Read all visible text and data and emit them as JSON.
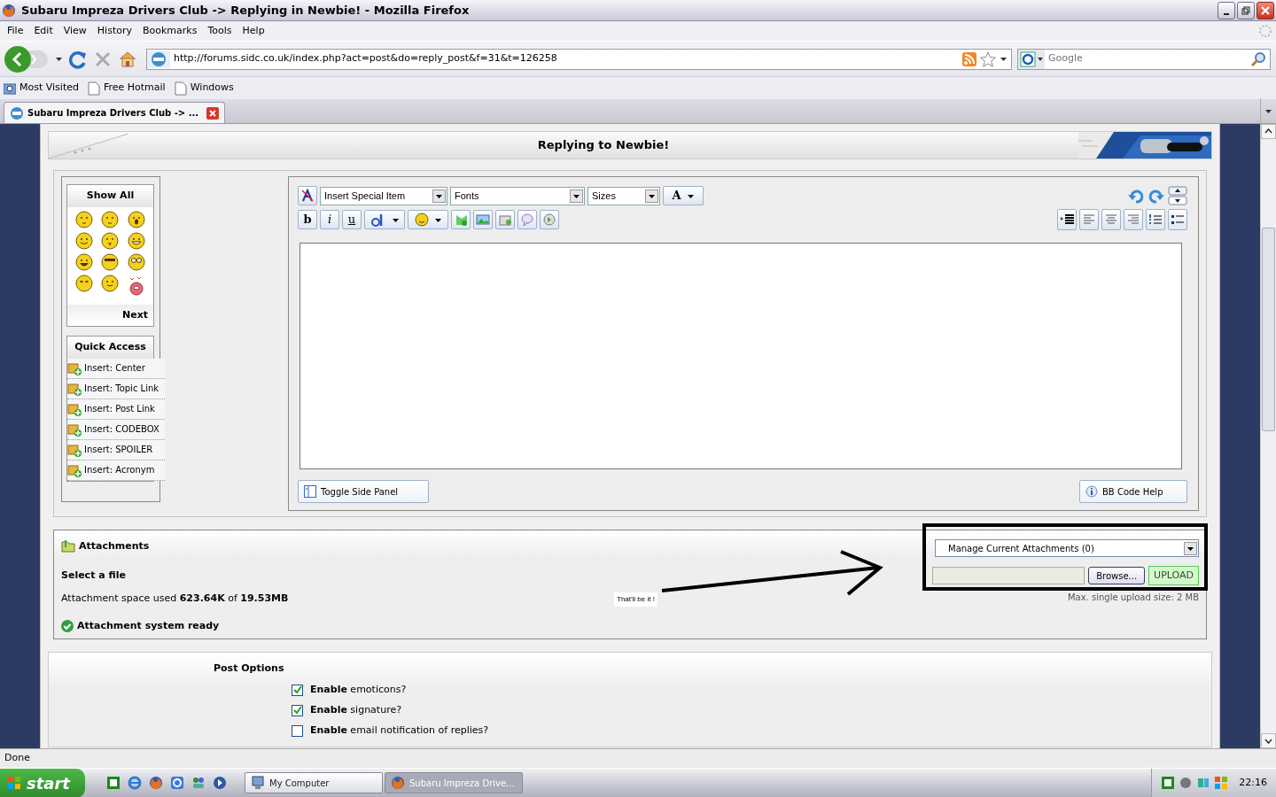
{
  "window": {
    "title": "Subaru Impreza Drivers Club -> Replying in Newbie! - Mozilla Firefox"
  },
  "menu": [
    "File",
    "Edit",
    "View",
    "History",
    "Bookmarks",
    "Tools",
    "Help"
  ],
  "address": {
    "value": "http://forums.sidc.co.uk/index.php?act=post&do=reply_post&f=31&t=126258"
  },
  "search": {
    "placeholder": "Google"
  },
  "bookmarks": [
    "Most Visited",
    "Free Hotmail",
    "Windows"
  ],
  "tabs": [
    {
      "label": "Subaru Impreza Drivers Club -> ...",
      "selected": true
    }
  ],
  "page": {
    "heading": "Replying to Newbie!",
    "emoticons": {
      "title": "Show All",
      "next": "Next"
    },
    "quick_access": {
      "title": "Quick Access",
      "items": [
        "Insert: Center",
        "Insert: Topic Link",
        "Insert: Post Link",
        "Insert: CODEBOX",
        "Insert: SPOILER",
        "Insert: Acronym"
      ]
    },
    "editor": {
      "selects": [
        "Insert Special Item",
        "Fonts",
        "Sizes"
      ],
      "color_button": "A",
      "format_buttons": [
        "b",
        "i",
        "u"
      ],
      "toggle_button": "Toggle Side Panel",
      "help_button": "BB Code Help"
    },
    "attachments": {
      "title": "Attachments",
      "select_label": "Select a file",
      "space": "Attachment space used **623.64K** of **19.53MB**",
      "status": "Attachment system ready",
      "manage": "Manage Current Attachments (0)",
      "browse": "Browse...",
      "upload": "UPLOAD",
      "max": "Max. single upload size: 2 MB",
      "note": "That'll be it !"
    },
    "post_options": {
      "title": "Post Options",
      "options": [
        {
          "label": "**Enable** emoticons?",
          "checked": true
        },
        {
          "label": "**Enable** signature?",
          "checked": true
        },
        {
          "label": "**Enable** email notification of replies?",
          "checked": false
        }
      ]
    }
  },
  "status_bar": "Done",
  "taskbar": {
    "start": "start",
    "windows": [
      {
        "label": "My Computer",
        "selected": false
      },
      {
        "label": "Subaru Impreza Drive...",
        "selected": true
      }
    ],
    "clock": "22:16"
  }
}
